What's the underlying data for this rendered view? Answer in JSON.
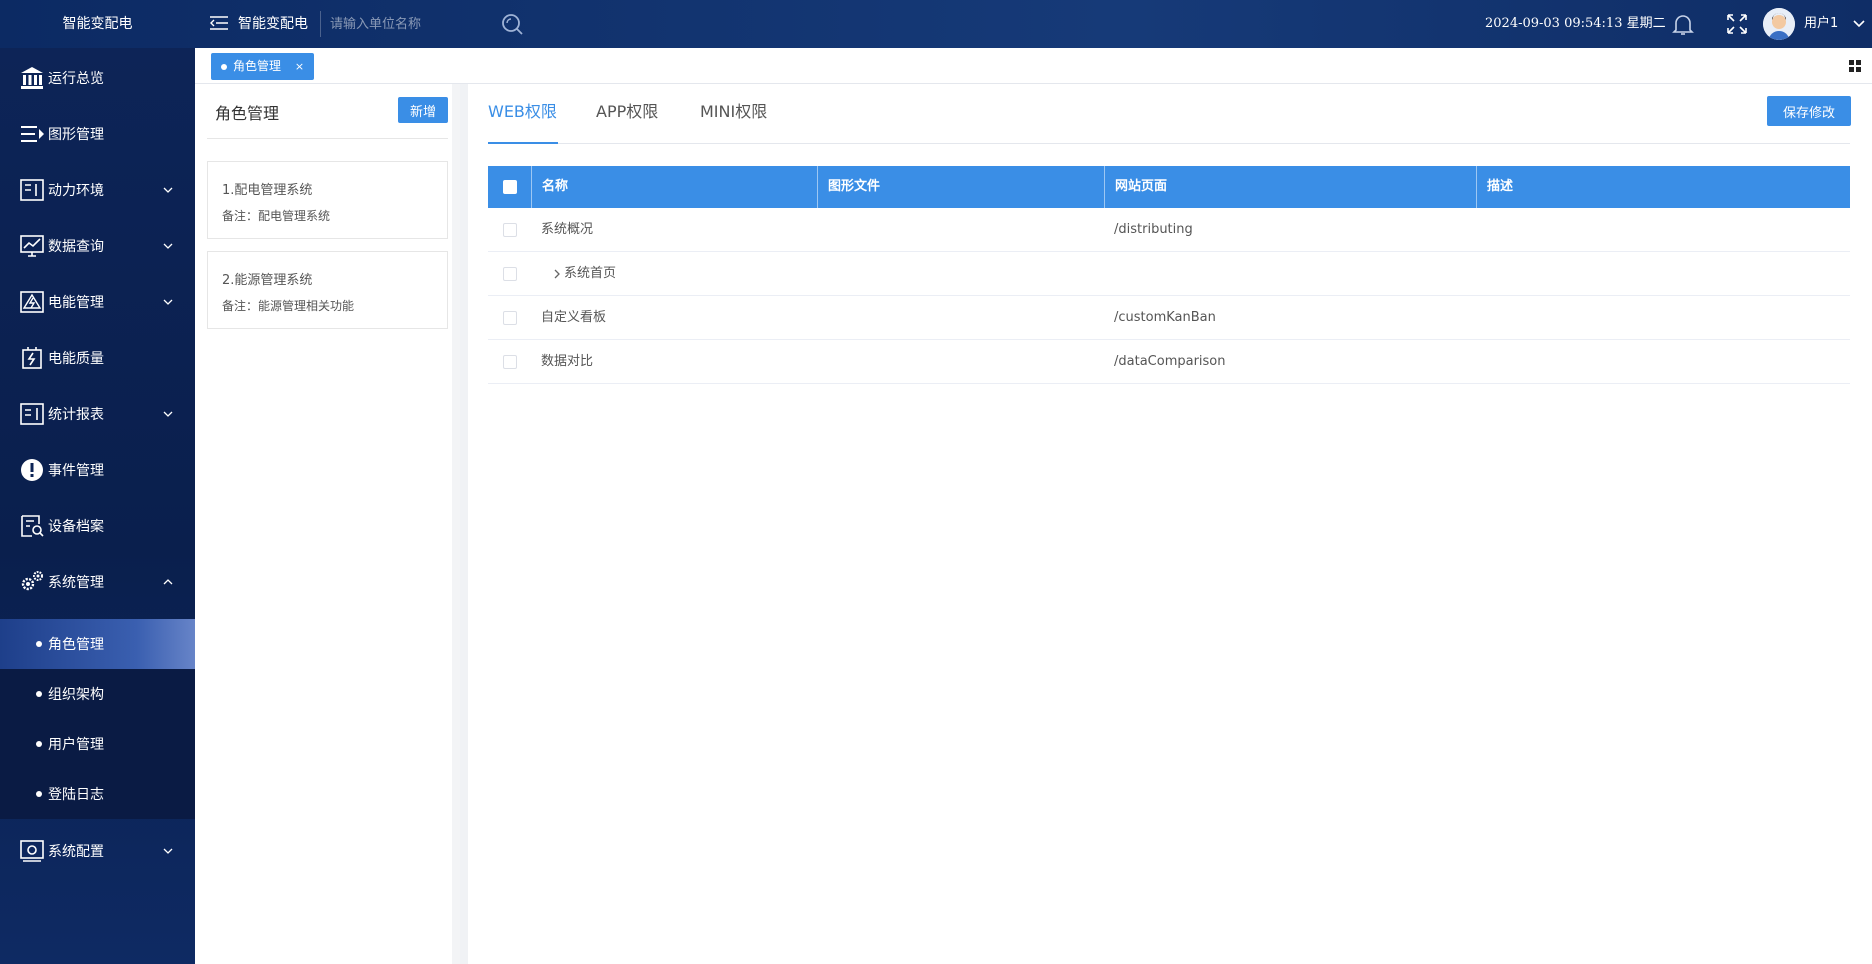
{
  "brand": {
    "name": "智能变配电"
  },
  "topbar": {
    "title": "智能变配电",
    "search_placeholder": "请输入单位名称",
    "datetime": "2024-09-03 09:54:13 星期二",
    "username": "用户1"
  },
  "sidebar": {
    "items": [
      {
        "label": "运行总览",
        "icon": "bank-icon",
        "expandable": false
      },
      {
        "label": "图形管理",
        "icon": "list-arrow-icon",
        "expandable": false
      },
      {
        "label": "动力环境",
        "icon": "panel-icon",
        "expandable": true
      },
      {
        "label": "数据查询",
        "icon": "monitor-chart-icon",
        "expandable": true
      },
      {
        "label": "电能管理",
        "icon": "power-icon",
        "expandable": true
      },
      {
        "label": "电能质量",
        "icon": "battery-bolt-icon",
        "expandable": false
      },
      {
        "label": "统计报表",
        "icon": "report-icon",
        "expandable": true
      },
      {
        "label": "事件管理",
        "icon": "alert-icon",
        "expandable": false
      },
      {
        "label": "设备档案",
        "icon": "file-search-icon",
        "expandable": false
      },
      {
        "label": "系统管理",
        "icon": "gears-icon",
        "expandable": true,
        "expanded": true
      },
      {
        "label": "系统配置",
        "icon": "screen-config-icon",
        "expandable": true
      }
    ],
    "sub_items": [
      {
        "label": "角色管理",
        "active": true
      },
      {
        "label": "组织架构",
        "active": false
      },
      {
        "label": "用户管理",
        "active": false
      },
      {
        "label": "登陆日志",
        "active": false
      }
    ]
  },
  "tabstrip": {
    "active_tab": "角色管理",
    "close_glyph": "×"
  },
  "roles_panel": {
    "title": "角色管理",
    "add_label": "新增",
    "roles": [
      {
        "name": "1.配电管理系统",
        "note": "备注：配电管理系统"
      },
      {
        "name": "2.能源管理系统",
        "note": "备注：能源管理相关功能"
      }
    ]
  },
  "permissions": {
    "tabs": [
      "WEB权限",
      "APP权限",
      "MINI权限"
    ],
    "active_tab": "WEB权限",
    "save_label": "保存修改",
    "columns": [
      "名称",
      "图形文件",
      "网站页面",
      "描述"
    ],
    "rows": [
      {
        "name": "系统概况",
        "graphic_file": "",
        "page": "/distributing",
        "description": "",
        "expandable": false
      },
      {
        "name": "系统首页",
        "graphic_file": "",
        "page": "",
        "description": "",
        "expandable": true
      },
      {
        "name": "自定义看板",
        "graphic_file": "",
        "page": "/customKanBan",
        "description": "",
        "expandable": false
      },
      {
        "name": "数据对比",
        "graphic_file": "",
        "page": "/dataComparison",
        "description": "",
        "expandable": false
      }
    ]
  },
  "colors": {
    "accent": "#3a8ee6",
    "topbar": "#0c2a63",
    "sidebar": "#0a1f4d"
  }
}
